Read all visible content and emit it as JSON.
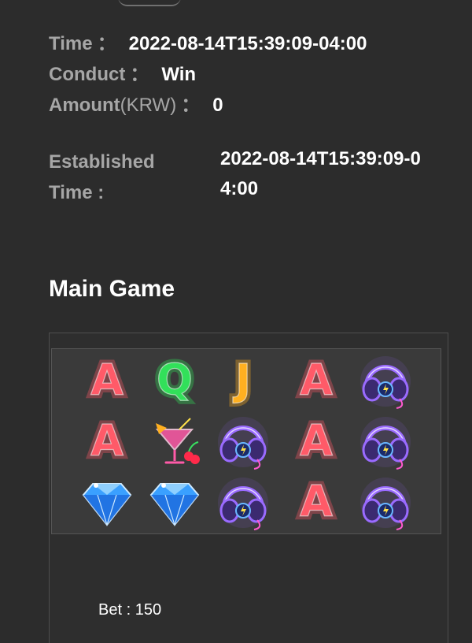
{
  "details": {
    "time_label": "Time",
    "time_colon": "：",
    "time_value": "2022-08-14T15:39:09-04:00",
    "conduct_label": "Conduct",
    "conduct_colon": "：",
    "conduct_value": "Win",
    "amount_label": "Amount",
    "amount_unit": "(KRW)",
    "amount_colon": "：",
    "amount_value": "0",
    "established_label": "Established Time :",
    "established_value": "2022-08-14T15:39:09-04:00"
  },
  "main_game": {
    "title": "Main Game",
    "grid": [
      [
        "letter-a",
        "letter-q",
        "letter-j",
        "letter-a",
        "headphones"
      ],
      [
        "letter-a",
        "cocktail",
        "headphones",
        "letter-a",
        "headphones"
      ],
      [
        "diamond",
        "diamond",
        "headphones",
        "letter-a",
        "headphones"
      ]
    ],
    "symbol_colors": {
      "letter-a": "#ff5a68",
      "letter-q": "#32e05a",
      "letter-j": "#ffb020",
      "cocktail": "#ff5aa8",
      "headphones": "#9a6bff",
      "diamond": "#3aa0ff"
    },
    "bet_label": "Bet",
    "bet_separator": " : ",
    "bet_value": "150"
  }
}
